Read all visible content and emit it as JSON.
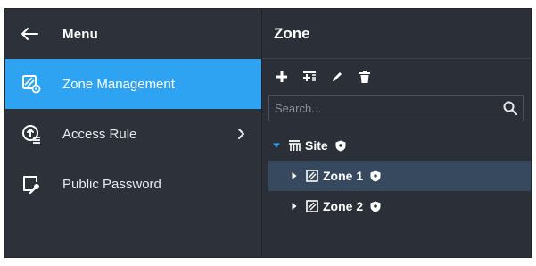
{
  "menu": {
    "title": "Menu",
    "items": [
      {
        "label": "Zone Management",
        "icon": "zone-management-icon",
        "active": true
      },
      {
        "label": "Access Rule",
        "icon": "access-rule-icon",
        "has_submenu": true
      },
      {
        "label": "Public Password",
        "icon": "public-password-icon"
      }
    ]
  },
  "zone": {
    "title": "Zone",
    "toolbar": [
      "add-icon",
      "add-sub-zone-icon",
      "edit-icon",
      "delete-icon"
    ],
    "search": {
      "placeholder": "Search...",
      "value": ""
    },
    "tree": {
      "root": {
        "label": "Site",
        "expanded": true
      },
      "children": [
        {
          "label": "Zone 1",
          "selected": true
        },
        {
          "label": "Zone 2",
          "selected": false
        }
      ]
    }
  },
  "colors": {
    "accent": "#2ea3f2",
    "panel": "#2d313a",
    "selected_row": "#36495e",
    "tree_expand": "#2ea3f2"
  }
}
